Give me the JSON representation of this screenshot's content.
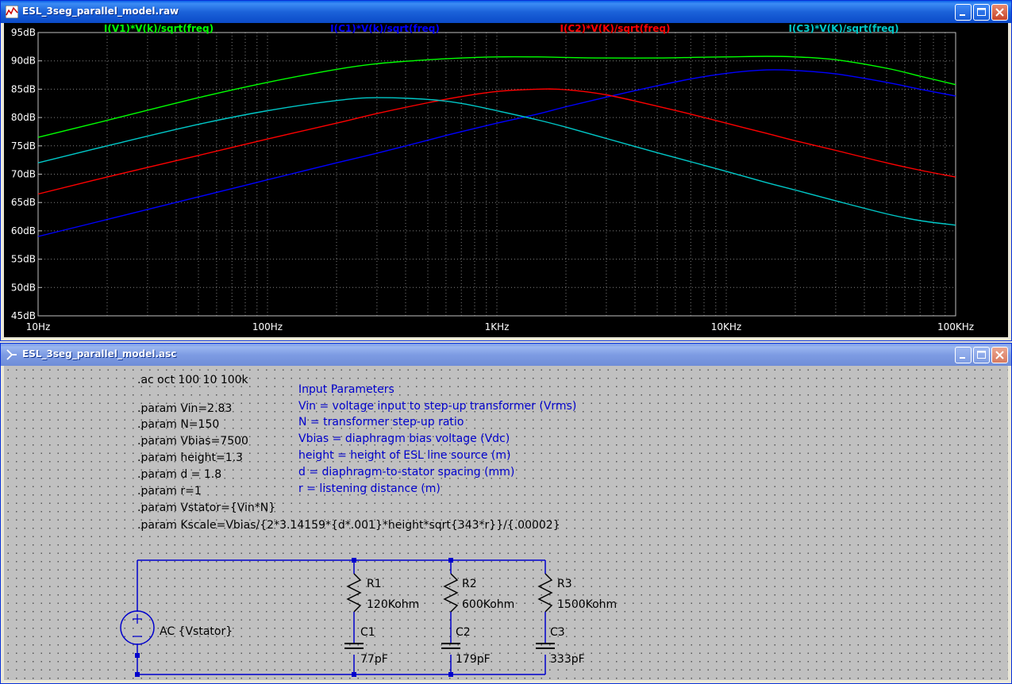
{
  "plot_window": {
    "title": "ESL_3seg_parallel_model.raw",
    "icon": "waveform-icon"
  },
  "chart_data": {
    "type": "line",
    "x_scale": "log",
    "xlim": [
      10,
      100000
    ],
    "ylim": [
      45,
      95
    ],
    "grid": "on",
    "legend_placement": "top",
    "x_ticks": [
      "10Hz",
      "100Hz",
      "1KHz",
      "10KHz",
      "100KHz"
    ],
    "y_ticks": [
      "95dB",
      "90dB",
      "85dB",
      "80dB",
      "75dB",
      "70dB",
      "65dB",
      "60dB",
      "55dB",
      "50dB",
      "45dB"
    ],
    "x": [
      10,
      20,
      50,
      100,
      200,
      300,
      500,
      700,
      1000,
      1500,
      2000,
      3000,
      5000,
      7000,
      10000,
      15000,
      20000,
      30000,
      50000,
      70000,
      100000
    ],
    "series": [
      {
        "name": "I(V1)*V(k)/sqrt(freq)",
        "color": "#00FF00",
        "values": [
          76.5,
          79.5,
          83.5,
          86.2,
          88.5,
          89.5,
          90.2,
          90.5,
          90.7,
          90.7,
          90.6,
          90.5,
          90.5,
          90.6,
          90.7,
          90.8,
          90.7,
          90.2,
          88.7,
          87.3,
          85.8
        ]
      },
      {
        "name": "I(C1)*V(k)/sqrt(freq)",
        "color": "#0000FF",
        "values": [
          59.0,
          62.0,
          66.0,
          69.0,
          72.0,
          73.7,
          76.0,
          77.5,
          79.0,
          80.6,
          81.9,
          83.6,
          85.6,
          86.8,
          87.8,
          88.4,
          88.3,
          87.7,
          86.2,
          85.0,
          83.8
        ]
      },
      {
        "name": "I(C2)*V(K)/sqrt(freq)",
        "color": "#FF0000",
        "values": [
          66.5,
          69.5,
          73.3,
          76.2,
          79.0,
          80.7,
          82.6,
          83.7,
          84.6,
          85.0,
          84.9,
          84.0,
          82.0,
          80.6,
          79.0,
          77.2,
          75.9,
          74.2,
          72.0,
          70.7,
          69.5
        ]
      },
      {
        "name": "I(C3)*V(K)/sqrt(freq)",
        "color": "#00C8C8",
        "values": [
          72.0,
          75.0,
          78.8,
          81.2,
          83.0,
          83.5,
          83.2,
          82.5,
          81.2,
          79.6,
          78.3,
          76.3,
          73.8,
          72.2,
          70.5,
          68.5,
          67.2,
          65.3,
          63.0,
          61.8,
          61.0
        ]
      }
    ]
  },
  "schematic_window": {
    "title": "ESL_3seg_parallel_model.asc",
    "icon": "schematic-icon",
    "directives": [
      ".ac oct 100 10 100k",
      ".param Vin=2.83",
      ".param N=150",
      ".param Vbias=7500",
      ".param height=1.3",
      ".param d = 1.8",
      ".param r=1",
      ".param Vstator={Vin*N}",
      ".param Kscale=Vbias/{2*3.14159*{d*.001}*height*sqrt{343*r}}/{.00002}"
    ],
    "comments": [
      "Input Parameters",
      "Vin = voltage input to step-up transformer (Vrms)",
      "N = transformer step-up ratio",
      "Vbias = diaphragm bias voltage (Vdc)",
      "height = height of ESL line source (m)",
      "d = diaphragm-to-stator spacing (mm)",
      "r = listening distance (m)"
    ],
    "source_label": "AC {Vstator}",
    "components": [
      {
        "r_name": "R1",
        "r_value": "120Kohm",
        "c_name": "C1",
        "c_value": "77pF"
      },
      {
        "r_name": "R2",
        "r_value": "600Kohm",
        "c_name": "C2",
        "c_value": "179pF"
      },
      {
        "r_name": "R3",
        "r_value": "1500Kohm",
        "c_name": "C3",
        "c_value": "333pF"
      }
    ],
    "wire_color": "#0000CC"
  }
}
